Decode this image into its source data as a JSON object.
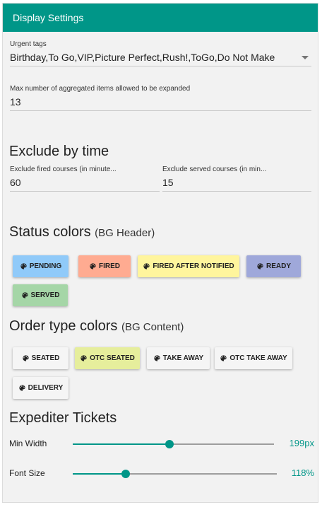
{
  "header": {
    "title": "Display Settings"
  },
  "urgent_tags": {
    "label": "Urgent tags",
    "value": "Birthday,To Go,VIP,Picture Perfect,Rush!,ToGo,Do Not Make"
  },
  "max_aggregated": {
    "label": "Max number of aggregated items allowed to be expanded",
    "value": "13"
  },
  "exclude_by_time": {
    "title": "Exclude by time",
    "fired": {
      "label": "Exclude fired courses (in minute...",
      "value": "60"
    },
    "served": {
      "label": "Exclude served courses (in min...",
      "value": "15"
    }
  },
  "status_colors": {
    "title": "Status colors",
    "subtitle": "(BG Header)",
    "chips": [
      {
        "label": "PENDING",
        "color": "#90caf9",
        "icon": "palette-icon"
      },
      {
        "label": "FIRED",
        "color": "#ffab91",
        "icon": "palette-icon"
      },
      {
        "label": "FIRED AFTER NOTIFIED",
        "color": "#fff59d",
        "icon": "palette-icon"
      },
      {
        "label": "READY",
        "color": "#9fa8da",
        "icon": "palette-icon"
      },
      {
        "label": "SERVED",
        "color": "#a5d6a7",
        "icon": "palette-icon"
      }
    ]
  },
  "order_type_colors": {
    "title": "Order type colors",
    "subtitle": "(BG Content)",
    "chips": [
      {
        "label": "SEATED",
        "color": "#f5f5f5",
        "icon": "palette-icon"
      },
      {
        "label": "OTC SEATED",
        "color": "#e6ee9c",
        "icon": "palette-icon"
      },
      {
        "label": "TAKE AWAY",
        "color": "#f5f5f5",
        "icon": "palette-icon"
      },
      {
        "label": "OTC TAKE AWAY",
        "color": "#f5f5f5",
        "icon": "palette-icon"
      },
      {
        "label": "DELIVERY",
        "color": "#f5f5f5",
        "icon": "palette-icon"
      }
    ]
  },
  "expediter": {
    "title": "Expediter Tickets",
    "min_width": {
      "label": "Min Width",
      "value": "199px",
      "fraction": 0.48
    },
    "font_size": {
      "label": "Font Size",
      "value": "118%",
      "fraction": 0.26
    }
  },
  "colors": {
    "accent": "#009688"
  }
}
